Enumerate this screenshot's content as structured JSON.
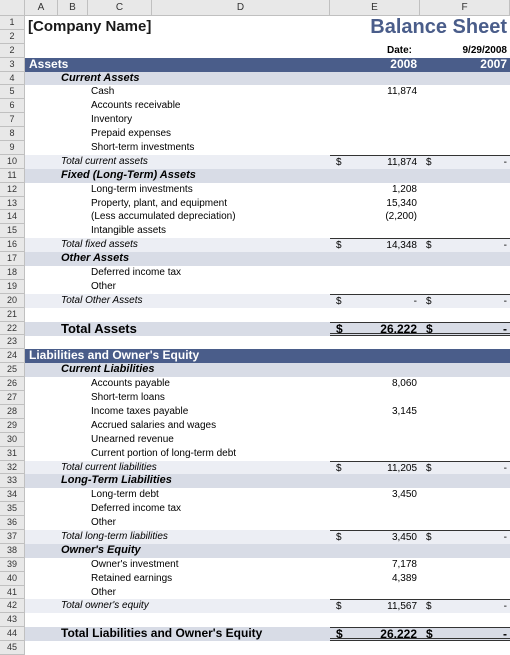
{
  "columns": [
    "A",
    "B",
    "C",
    "D",
    "E",
    "F"
  ],
  "company_name": "[Company Name]",
  "sheet_title": "Balance Sheet",
  "date_label": "Date:",
  "date_value": "9/29/2008",
  "year_current": "2008",
  "year_prior": "2007",
  "assets": {
    "header": "Assets",
    "current": {
      "header": "Current Assets",
      "items": {
        "cash": {
          "label": "Cash",
          "v2008": "11,874",
          "v2007": ""
        },
        "ar": {
          "label": "Accounts receivable",
          "v2008": "",
          "v2007": ""
        },
        "inv": {
          "label": "Inventory",
          "v2008": "",
          "v2007": ""
        },
        "prepaid": {
          "label": "Prepaid expenses",
          "v2008": "",
          "v2007": ""
        },
        "sti": {
          "label": "Short-term investments",
          "v2008": "",
          "v2007": ""
        }
      },
      "total_label": "Total current assets",
      "total_2008": "11,874",
      "total_2007": "-"
    },
    "fixed": {
      "header": "Fixed (Long-Term) Assets",
      "items": {
        "lti": {
          "label": "Long-term investments",
          "v2008": "1,208",
          "v2007": ""
        },
        "ppe": {
          "label": "Property, plant, and equipment",
          "v2008": "15,340",
          "v2007": ""
        },
        "dep": {
          "label": "(Less accumulated depreciation)",
          "v2008": "(2,200)",
          "v2007": ""
        },
        "intang": {
          "label": "Intangible assets",
          "v2008": "",
          "v2007": ""
        }
      },
      "total_label": "Total fixed assets",
      "total_2008": "14,348",
      "total_2007": "-"
    },
    "other": {
      "header": "Other Assets",
      "items": {
        "dit": {
          "label": "Deferred income tax",
          "v2008": "",
          "v2007": ""
        },
        "other": {
          "label": "Other",
          "v2008": "",
          "v2007": ""
        }
      },
      "total_label": "Total Other Assets",
      "total_2008": "-",
      "total_2007": "-"
    },
    "grand_total_label": "Total Assets",
    "grand_total_2008": "26,222",
    "grand_total_2007": "-"
  },
  "liabilities": {
    "header": "Liabilities and Owner's Equity",
    "current": {
      "header": "Current Liabilities",
      "items": {
        "ap": {
          "label": "Accounts payable",
          "v2008": "8,060",
          "v2007": ""
        },
        "stl": {
          "label": "Short-term loans",
          "v2008": "",
          "v2007": ""
        },
        "itp": {
          "label": "Income taxes payable",
          "v2008": "3,145",
          "v2007": ""
        },
        "asw": {
          "label": "Accrued salaries and wages",
          "v2008": "",
          "v2007": ""
        },
        "ur": {
          "label": "Unearned revenue",
          "v2008": "",
          "v2007": ""
        },
        "cpltd": {
          "label": "Current portion of long-term debt",
          "v2008": "",
          "v2007": ""
        }
      },
      "total_label": "Total current liabilities",
      "total_2008": "11,205",
      "total_2007": "-"
    },
    "longterm": {
      "header": "Long-Term Liabilities",
      "items": {
        "ltd": {
          "label": "Long-term debt",
          "v2008": "3,450",
          "v2007": ""
        },
        "dit": {
          "label": "Deferred income tax",
          "v2008": "",
          "v2007": ""
        },
        "other": {
          "label": "Other",
          "v2008": "",
          "v2007": ""
        }
      },
      "total_label": "Total long-term liabilities",
      "total_2008": "3,450",
      "total_2007": "-"
    },
    "equity": {
      "header": "Owner's Equity",
      "items": {
        "oi": {
          "label": "Owner's investment",
          "v2008": "7,178",
          "v2007": ""
        },
        "re": {
          "label": "Retained earnings",
          "v2008": "4,389",
          "v2007": ""
        },
        "other": {
          "label": "Other",
          "v2008": "",
          "v2007": ""
        }
      },
      "total_label": "Total owner's equity",
      "total_2008": "11,567",
      "total_2007": "-"
    },
    "grand_total_label": "Total Liabilities and Owner's Equity",
    "grand_total_2008": "26,222",
    "grand_total_2007": "-"
  }
}
